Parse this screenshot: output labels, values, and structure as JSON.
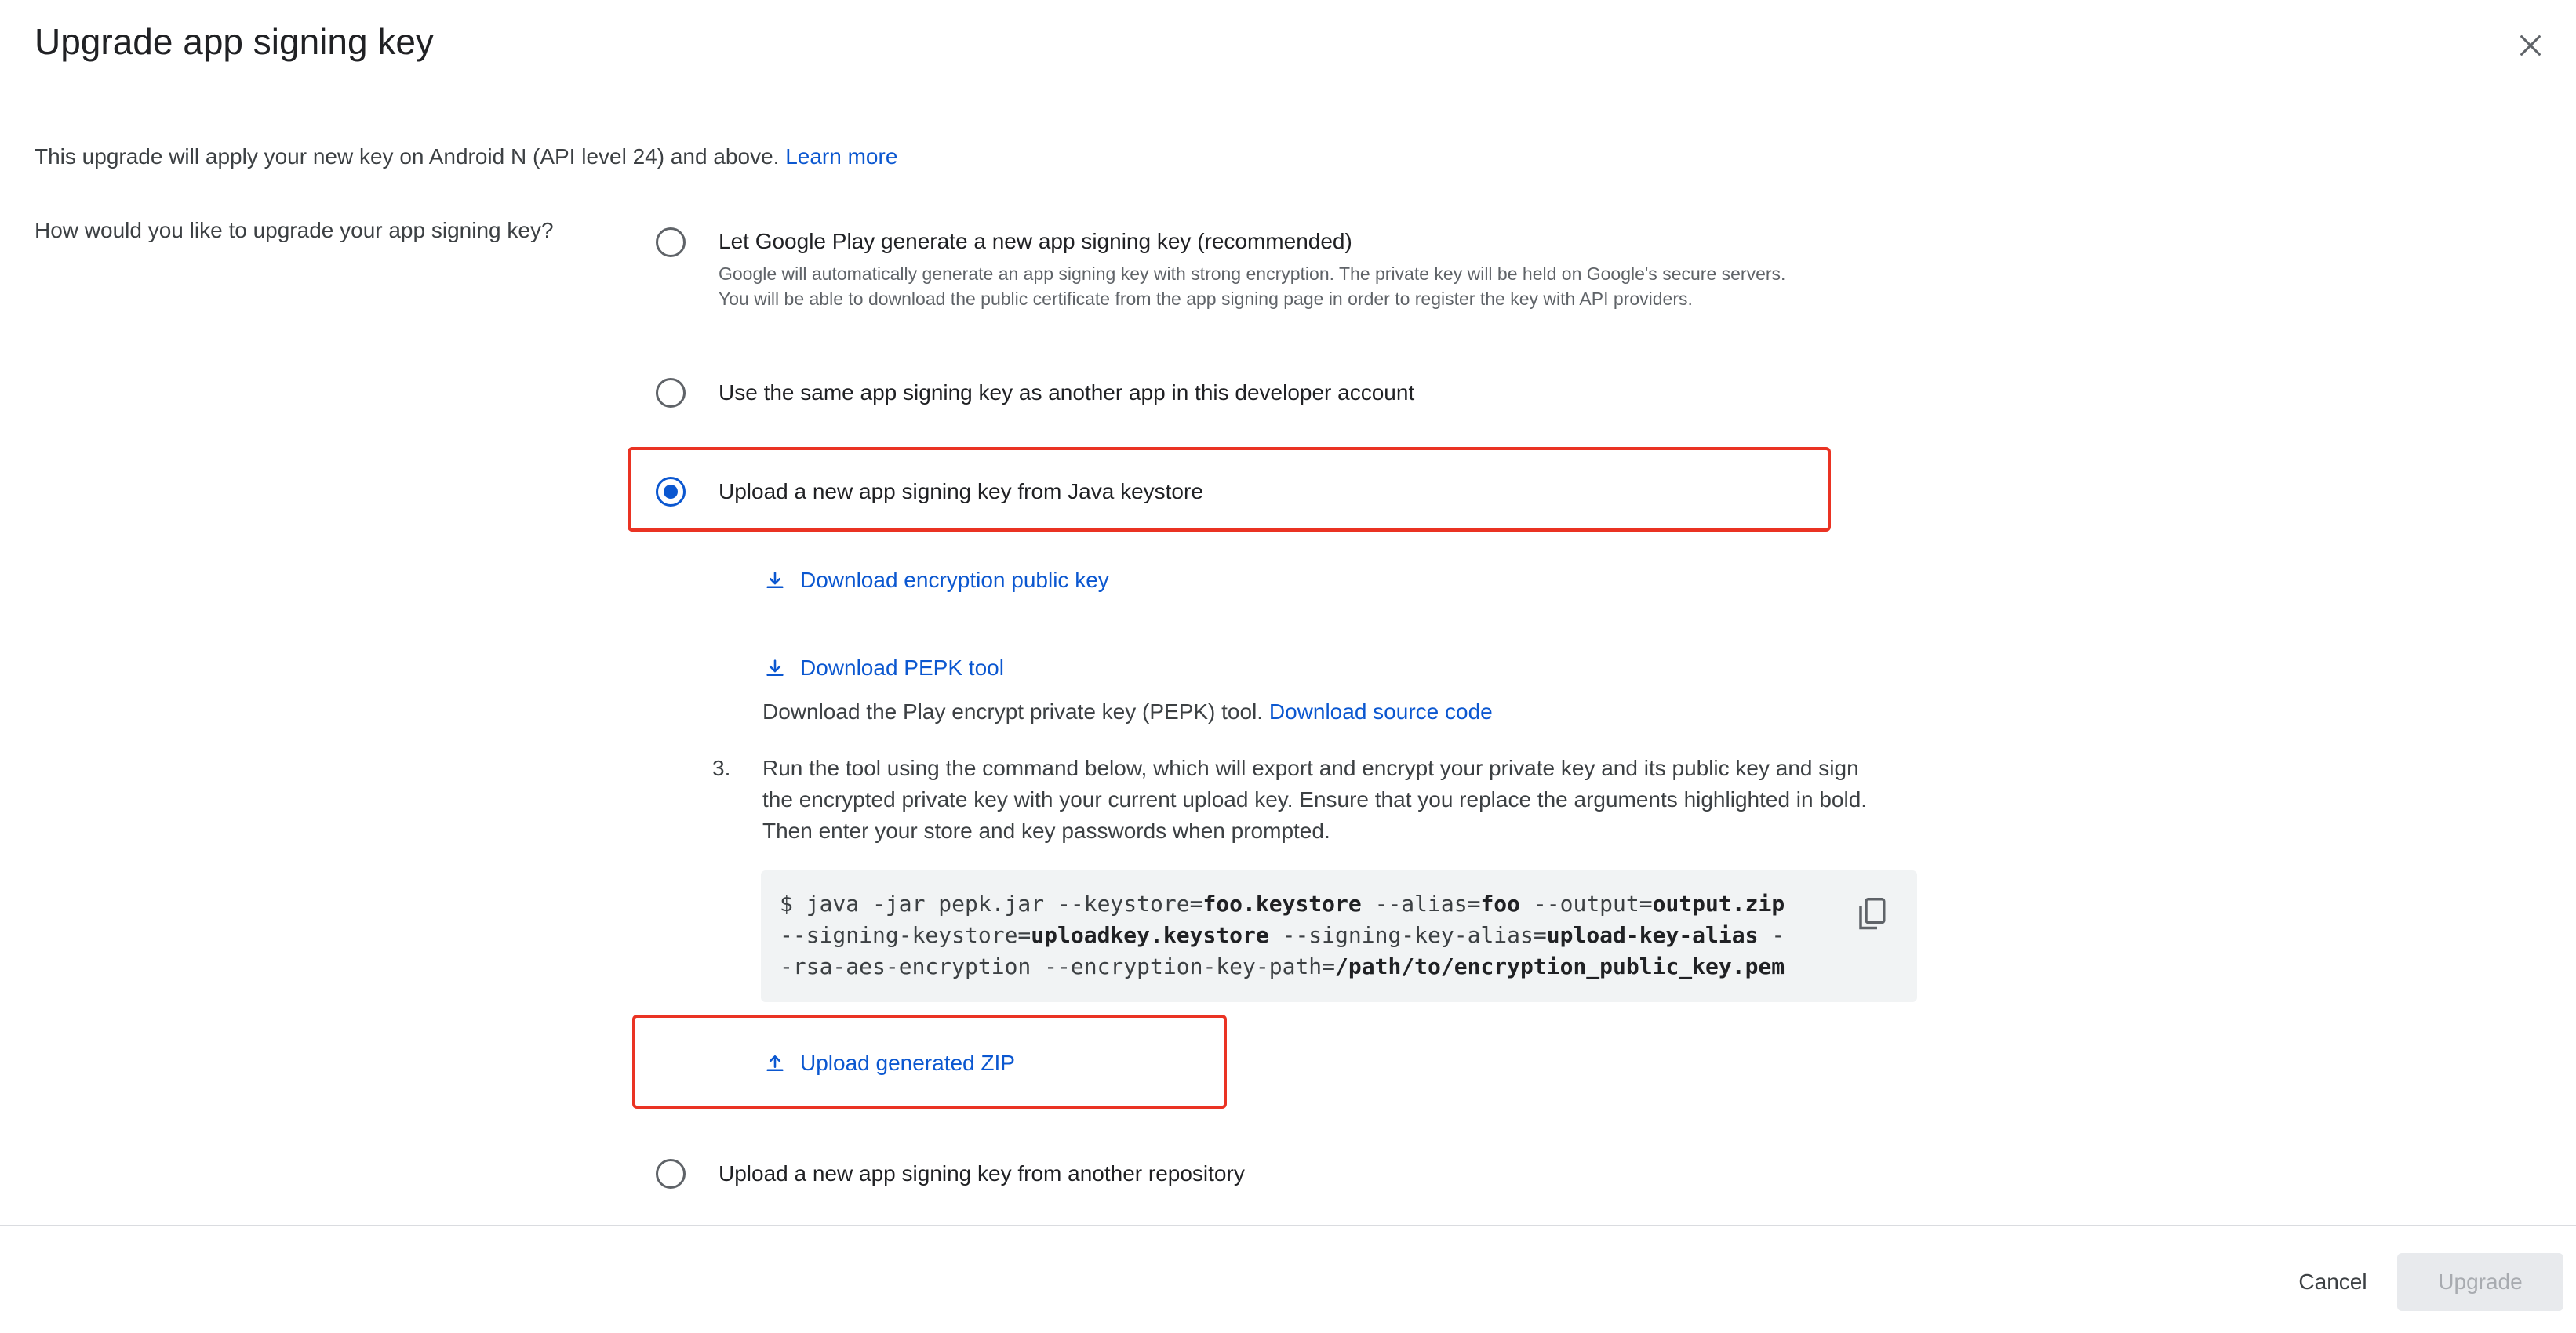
{
  "dialog": {
    "title": "Upgrade app signing key",
    "intro_text": "This upgrade will apply your new key on Android N (API level 24) and above.",
    "learn_more": "Learn more",
    "question": "How would you like to upgrade your app signing key?"
  },
  "options": [
    {
      "label": "Let Google Play generate a new app signing key (recommended)",
      "desc_line1": "Google will automatically generate an app signing key with strong encryption. The private key will be held on Google's secure servers.",
      "desc_line2": "You will be able to download the public certificate from the app signing page in order to register the key with API providers.",
      "selected": false
    },
    {
      "label": "Use the same app signing key as another app in this developer account",
      "selected": false
    },
    {
      "label": "Upload a new app signing key from Java keystore",
      "selected": true
    },
    {
      "label": "Upload a new app signing key from another repository",
      "selected": false
    }
  ],
  "keystore_steps": {
    "download_key": "Download encryption public key",
    "download_pepk": "Download PEPK tool",
    "pepk_desc": "Download the Play encrypt private key (PEPK) tool.",
    "download_source": "Download source code",
    "step3_number": "3.",
    "step3_line1": "Run the tool using the command below, which will export and encrypt your private key and its public key and sign",
    "step3_line2": "the encrypted private key with your current upload key. Ensure that you replace the arguments highlighted in bold.",
    "step3_line3": "Then enter your store and key passwords when prompted.",
    "command": {
      "l1_a": "$ java -jar pepk.jar --keystore=",
      "l1_b": "foo.keystore",
      "l1_c": " --alias=",
      "l1_d": "foo",
      "l1_e": " --output=",
      "l1_f": "output.zip",
      "l2_a": "--signing-keystore=",
      "l2_b": "uploadkey.keystore",
      "l2_c": " --signing-key-alias=",
      "l2_d": "upload-key-alias",
      "l2_e": " -",
      "l3_a": "-rsa-aes-encryption --encryption-key-path=",
      "l3_b": "/path/to/encryption_public_key.pem"
    },
    "upload_zip": "Upload generated ZIP"
  },
  "footer": {
    "cancel": "Cancel",
    "upgrade": "Upgrade"
  },
  "colors": {
    "accent": "#0b57d0",
    "highlight_border": "#ea3323",
    "disabled_bg": "#e8eaed"
  }
}
